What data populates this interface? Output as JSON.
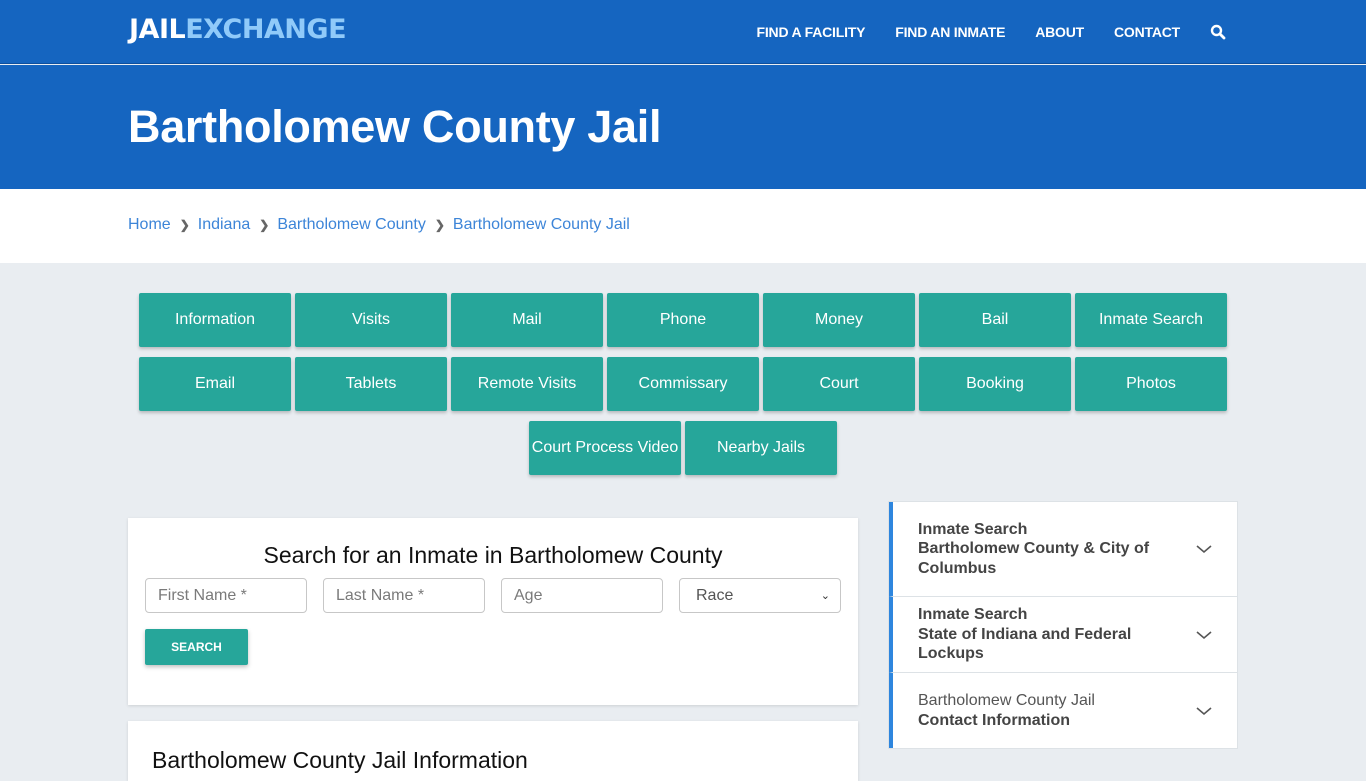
{
  "header": {
    "logo_part1": "JAIL",
    "logo_part2": "EXCHANGE",
    "nav": [
      "FIND A FACILITY",
      "FIND AN INMATE",
      "ABOUT",
      "CONTACT"
    ],
    "search_icon": "search-icon"
  },
  "hero": {
    "title": "Bartholomew County Jail"
  },
  "breadcrumb": [
    "Home",
    "Indiana",
    "Bartholomew County",
    "Bartholomew County Jail"
  ],
  "topic_buttons": [
    "Information",
    "Visits",
    "Mail",
    "Phone",
    "Money",
    "Bail",
    "Inmate Search",
    "Email",
    "Tablets",
    "Remote Visits",
    "Commissary",
    "Court",
    "Booking",
    "Photos",
    "Court Process Video",
    "Nearby Jails"
  ],
  "search_form": {
    "title": "Search for an Inmate in Bartholomew County",
    "first_name_placeholder": "First Name *",
    "last_name_placeholder": "Last Name *",
    "age_placeholder": "Age",
    "race_selected": "Race",
    "submit_label": "SEARCH"
  },
  "info_section": {
    "title": "Bartholomew County Jail Information"
  },
  "sidebar": {
    "items": [
      {
        "line1": "Inmate Search",
        "line2": "Bartholomew County & City of Columbus"
      },
      {
        "line1": "Inmate Search",
        "line2": "State of Indiana and Federal Lockups"
      },
      {
        "line1": "Bartholomew County Jail",
        "line2": "Contact Information"
      }
    ]
  },
  "colors": {
    "brand_blue": "#1565c0",
    "teal": "#26a69a",
    "link_blue": "#3d85d8",
    "accent_border": "#2e86de"
  }
}
